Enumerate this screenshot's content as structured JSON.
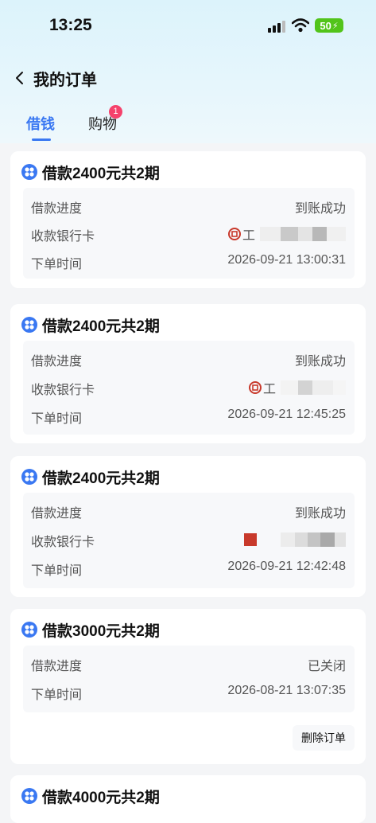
{
  "status_bar": {
    "time": "13:25",
    "battery": "50"
  },
  "nav": {
    "title": "我的订单"
  },
  "tabs": [
    {
      "label": "借钱",
      "active": true
    },
    {
      "label": "购物",
      "badge": "1"
    }
  ],
  "orders": [
    {
      "title": "借款2400元共2期",
      "rows": [
        {
          "label": "借款进度",
          "value": "到账成功"
        },
        {
          "label": "收款银行卡",
          "value": "工"
        },
        {
          "label": "下单时间",
          "value": "2026-09-21 13:00:31"
        }
      ]
    },
    {
      "title": "借款2400元共2期",
      "rows": [
        {
          "label": "借款进度",
          "value": "到账成功"
        },
        {
          "label": "收款银行卡",
          "value": "工"
        },
        {
          "label": "下单时间",
          "value": "2026-09-21 12:45:25"
        }
      ]
    },
    {
      "title": "借款2400元共2期",
      "rows": [
        {
          "label": "借款进度",
          "value": "到账成功"
        },
        {
          "label": "收款银行卡",
          "value": ""
        },
        {
          "label": "下单时间",
          "value": "2026-09-21 12:42:48"
        }
      ]
    },
    {
      "title": "借款3000元共2期",
      "rows": [
        {
          "label": "借款进度",
          "value": "已关闭"
        },
        {
          "label": "下单时间",
          "value": "2026-08-21 13:07:35"
        }
      ],
      "action": "删除订单"
    },
    {
      "title": "借款4000元共2期"
    }
  ],
  "colors": {
    "accent": "#3a78f2",
    "badge": "#f5426c",
    "bank_red": "#c8392b"
  }
}
